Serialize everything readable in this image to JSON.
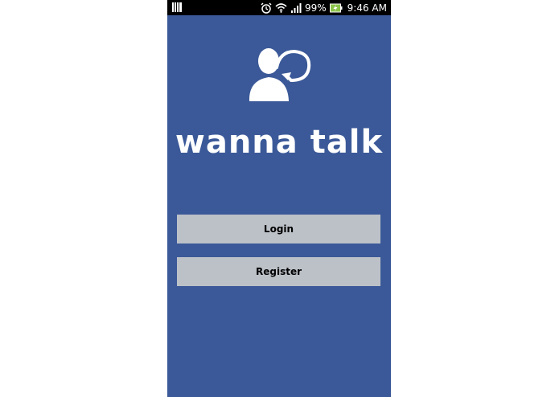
{
  "status_bar": {
    "battery_percent": "99%",
    "time": "9:46 AM",
    "icons": [
      "notification-bars-icon",
      "alarm-icon",
      "wifi-icon",
      "signal-icon",
      "battery-charging-icon"
    ]
  },
  "app": {
    "title": "wanna talk",
    "logo_icon": "person-speech-icon"
  },
  "buttons": {
    "login_label": "Login",
    "register_label": "Register"
  },
  "colors": {
    "background": "#3b5998",
    "button_bg": "#bcc1c8",
    "battery_accent": "#8bc34a"
  }
}
